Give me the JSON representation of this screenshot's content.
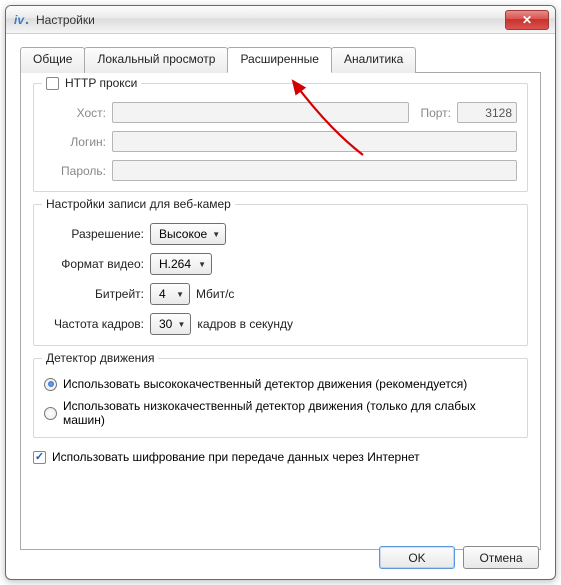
{
  "window": {
    "title": "Настройки"
  },
  "tabs": [
    {
      "label": "Общие"
    },
    {
      "label": "Локальный просмотр"
    },
    {
      "label": "Расширенные"
    },
    {
      "label": "Аналитика"
    }
  ],
  "proxy": {
    "checkbox_label": "HTTP прокси",
    "host_label": "Хост:",
    "host_value": "",
    "port_label": "Порт:",
    "port_value": "3128",
    "login_label": "Логин:",
    "login_value": "",
    "password_label": "Пароль:",
    "password_value": ""
  },
  "webcam": {
    "legend": "Настройки записи для веб-камер",
    "resolution_label": "Разрешение:",
    "resolution_value": "Высокое",
    "format_label": "Формат видео:",
    "format_value": "H.264",
    "bitrate_label": "Битрейт:",
    "bitrate_value": "4",
    "bitrate_suffix": "Мбит/с",
    "fps_label": "Частота кадров:",
    "fps_value": "30",
    "fps_suffix": "кадров в секунду"
  },
  "detector": {
    "legend": "Детектор движения",
    "option_hq": "Использовать высококачественный детектор движения (рекомендуется)",
    "option_lq": "Использовать низкокачественный детектор движения (только для слабых машин)"
  },
  "encryption_label": "Использовать шифрование при передаче данных через Интернет",
  "buttons": {
    "ok": "OK",
    "cancel": "Отмена"
  }
}
